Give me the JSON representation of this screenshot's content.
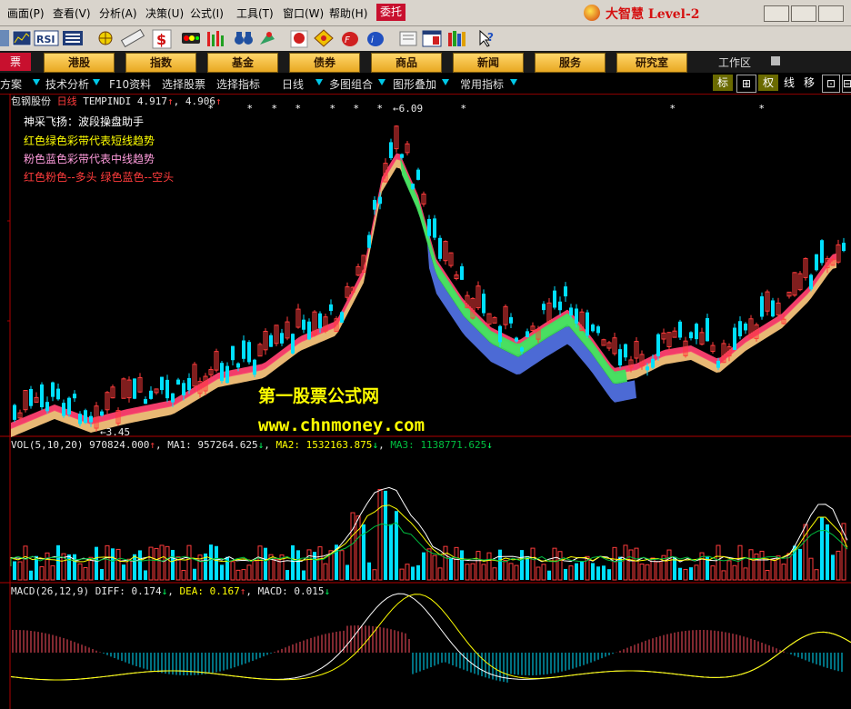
{
  "menu": {
    "items": [
      "画面(P)",
      "查看(V)",
      "分析(A)",
      "决策(U)",
      "公式(I)",
      "工具(T)",
      "窗口(W)",
      "帮助(H)"
    ],
    "weituo": "委托",
    "brand": "大智慧 Level-2"
  },
  "toolbar": {
    "icons": [
      "back-icon",
      "chart-icon",
      "rsi-icon",
      "table-icon",
      "crosshair-icon",
      "ruler-icon",
      "dollar-icon",
      "indicator-icon",
      "bars-icon",
      "binoculars-icon",
      "alarm-icon",
      "favorite-icon",
      "diamond-icon",
      "f10-icon",
      "info-icon",
      "notepad-icon",
      "window-icon",
      "books-icon",
      "help-icon"
    ]
  },
  "nav": {
    "left_label": "票",
    "buttons": [
      "港股",
      "指数",
      "基金",
      "债券",
      "商品",
      "新闻",
      "服务",
      "研究室"
    ],
    "workzone": "工作区"
  },
  "funcbar": {
    "items": [
      "方案",
      "技术分析",
      "F10资料",
      "选择股票",
      "选择指标",
      "日线",
      "多图组合",
      "图形叠加",
      "常用指标"
    ],
    "right": [
      "标",
      "⊞",
      "权",
      "线",
      "移",
      "⊡",
      "⊟"
    ]
  },
  "main": {
    "stock_name": "包钢股份",
    "period": "日线",
    "indicator": "TEMPINDI",
    "val1": "4.917",
    "val2": "4.906",
    "high_label": "6.09",
    "low_label": "3.45",
    "notes": [
      "神采飞扬：波段操盘助手",
      "红色绿色彩带代表短线趋势",
      "粉色蓝色彩带代表中线趋势",
      "红色粉色--多头   绿色蓝色--空头"
    ]
  },
  "volume": {
    "name": "VOL(5,10,20)",
    "value": "970824.000",
    "ma1_label": "MA1:",
    "ma1": "957264.625",
    "ma2_label": "MA2:",
    "ma2": "1532163.875",
    "ma3_label": "MA3:",
    "ma3": "1138771.625"
  },
  "macd": {
    "name": "MACD(26,12,9)",
    "diff_label": "DIFF:",
    "diff": "0.174",
    "dea_label": "DEA:",
    "dea": "0.167",
    "macd_label": "MACD:",
    "macd": "0.015"
  },
  "watermark": {
    "title": "第一股票公式网",
    "url": "www.chnmoney.com"
  },
  "colors": {
    "up": "#ff3c3c",
    "down": "#00e0ff",
    "frame": "#b00000",
    "gold": "#ffd66a"
  }
}
